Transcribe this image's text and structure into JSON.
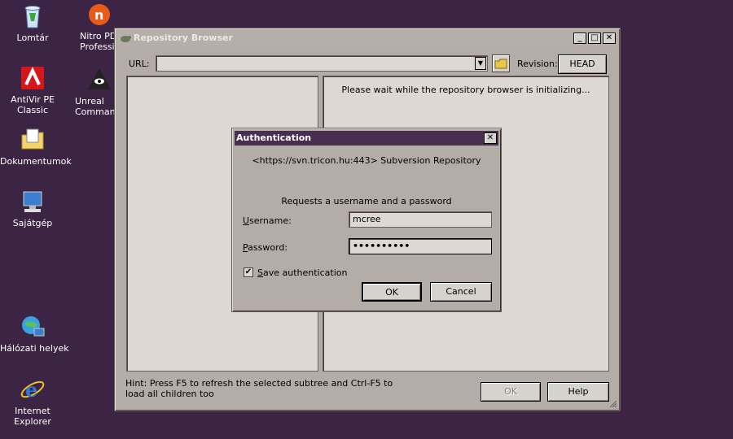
{
  "desktop": {
    "icons": [
      {
        "label": "Lomtár"
      },
      {
        "label": "Nitro PD",
        "label2": "Profession"
      },
      {
        "label": "AntiVir PE",
        "label2": "Classic"
      },
      {
        "label": "Unreal",
        "label2": "Command"
      },
      {
        "label": "Dokumentumok"
      },
      {
        "label": "Sajátgép"
      },
      {
        "label": "Hálózati helyek"
      },
      {
        "label": "Internet",
        "label2": "Explorer"
      }
    ]
  },
  "window": {
    "title": "Repository Browser",
    "url_label": "URL:",
    "url_value": "",
    "revision_label": "Revision:",
    "revision_button": "HEAD",
    "wait_text": "Please wait while the repository browser is initializing...",
    "hint_text": "Hint: Press F5 to refresh the selected subtree and Ctrl-F5 to load all children too",
    "ok_label": "OK",
    "help_label": "Help"
  },
  "dialog": {
    "title": "Authentication",
    "realm": "<https://svn.tricon.hu:443> Subversion Repository",
    "prompt": "Requests a username and a password",
    "username_label_u": "U",
    "username_label_rest": "sername:",
    "username_value": "mcree",
    "password_label_u": "P",
    "password_label_rest": "assword:",
    "password_value": "••••••••••",
    "save_label_u": "S",
    "save_label_rest": "ave authentication",
    "save_checked": "✔",
    "ok_label": "OK",
    "cancel_label": "Cancel"
  },
  "colors": {
    "desktop": "#3c2444",
    "dialog_title": "#4a2e52",
    "window_face": "#b4aca6"
  }
}
